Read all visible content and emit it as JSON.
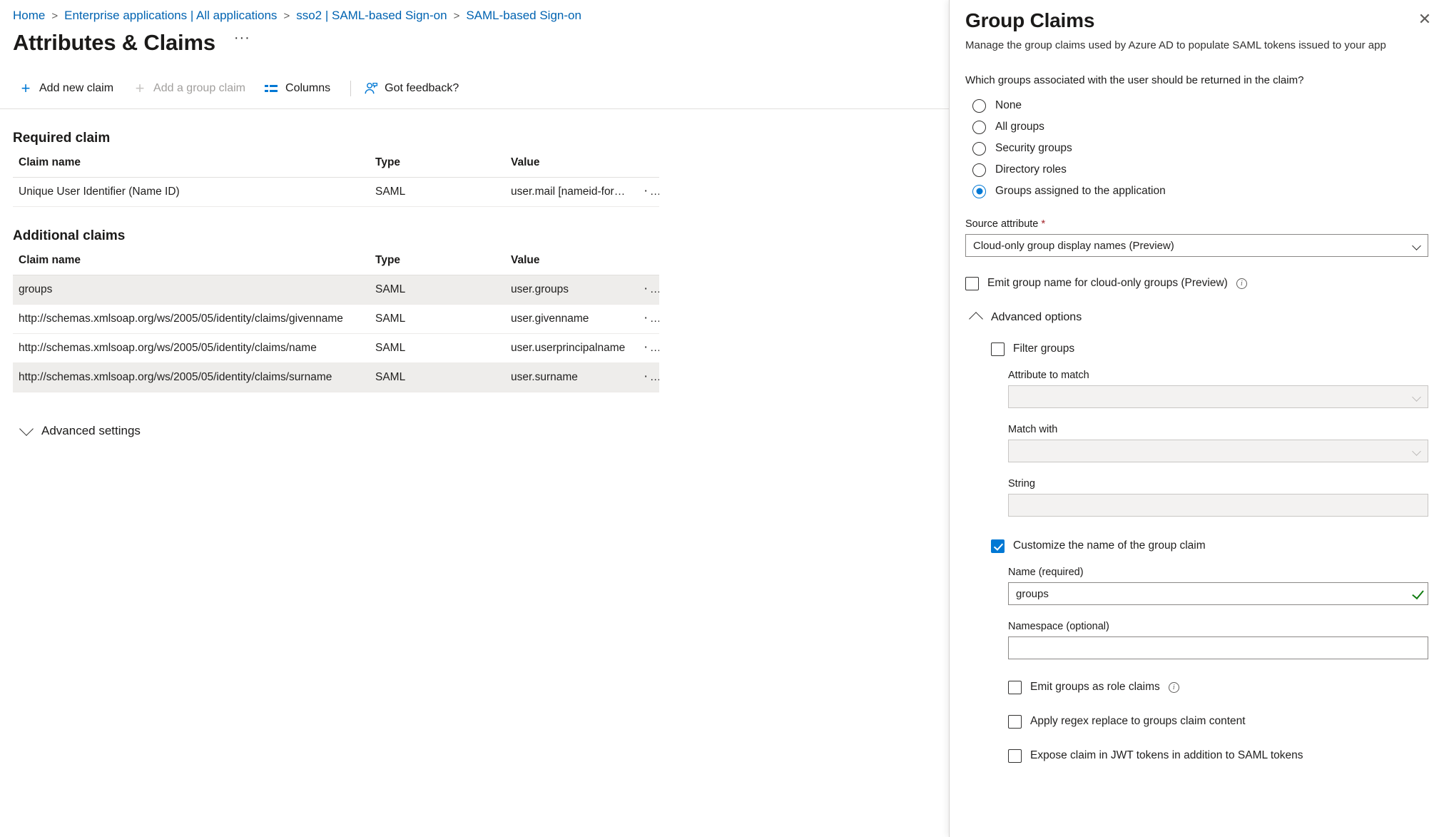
{
  "breadcrumb": [
    "Home",
    "Enterprise applications | All applications",
    "sso2 | SAML-based Sign-on",
    "SAML-based Sign-on"
  ],
  "page": {
    "title": "Attributes & Claims",
    "ellipsis": "···"
  },
  "toolbar": {
    "add_new_claim": "Add new claim",
    "add_group_claim": "Add a group claim",
    "columns": "Columns",
    "got_feedback": "Got feedback?"
  },
  "required_claim": {
    "heading": "Required claim",
    "columns": [
      "Claim name",
      "Type",
      "Value"
    ],
    "rows": [
      {
        "name": "Unique User Identifier (Name ID)",
        "type": "SAML",
        "value": "user.mail [nameid-forma…",
        "menu": "···"
      }
    ]
  },
  "additional_claims": {
    "heading": "Additional claims",
    "columns": [
      "Claim name",
      "Type",
      "Value"
    ],
    "rows": [
      {
        "name": "groups",
        "type": "SAML",
        "value": "user.groups",
        "menu": "···"
      },
      {
        "name": "http://schemas.xmlsoap.org/ws/2005/05/identity/claims/givenname",
        "type": "SAML",
        "value": "user.givenname",
        "menu": "···"
      },
      {
        "name": "http://schemas.xmlsoap.org/ws/2005/05/identity/claims/name",
        "type": "SAML",
        "value": "user.userprincipalname",
        "menu": "···"
      },
      {
        "name": "http://schemas.xmlsoap.org/ws/2005/05/identity/claims/surname",
        "type": "SAML",
        "value": "user.surname",
        "menu": "···"
      }
    ]
  },
  "advanced_settings": {
    "label": "Advanced settings",
    "expanded": false
  },
  "panel": {
    "title": "Group Claims",
    "subtitle": "Manage the group claims used by Azure AD to populate SAML tokens issued to your app",
    "close": "✕",
    "question": "Which groups associated with the user should be returned in the claim?",
    "radio_options": [
      {
        "label": "None",
        "selected": false
      },
      {
        "label": "All groups",
        "selected": false
      },
      {
        "label": "Security groups",
        "selected": false
      },
      {
        "label": "Directory roles",
        "selected": false
      },
      {
        "label": "Groups assigned to the application",
        "selected": true
      }
    ],
    "source_attribute": {
      "label": "Source attribute",
      "required_marker": "*",
      "value": "Cloud-only group display names (Preview)"
    },
    "emit_group_name": {
      "label": "Emit group name for cloud-only groups (Preview)",
      "checked": false,
      "info": "i"
    },
    "advanced_options": {
      "label": "Advanced options",
      "expanded": true,
      "filter_groups": {
        "label": "Filter groups",
        "checked": false
      },
      "attribute_to_match": {
        "label": "Attribute to match",
        "value": "",
        "disabled": true
      },
      "match_with": {
        "label": "Match with",
        "value": "",
        "disabled": true
      },
      "string": {
        "label": "String",
        "value": "",
        "disabled": true
      },
      "customize_name": {
        "label": "Customize the name of the group claim",
        "checked": true
      },
      "name_required": {
        "label": "Name (required)",
        "value": "groups",
        "valid": true
      },
      "namespace": {
        "label": "Namespace (optional)",
        "value": ""
      },
      "emit_groups_as_role_claims": {
        "label": "Emit groups as role claims",
        "checked": false,
        "info": "i"
      },
      "apply_regex_replace": {
        "label": "Apply regex replace to groups claim content",
        "checked": false
      },
      "expose_claim_jwt": {
        "label": "Expose claim in JWT tokens in addition to SAML tokens",
        "checked": false
      }
    }
  },
  "colors": {
    "accent": "#0078d4",
    "link": "#0063b1",
    "required": "#a4262c",
    "valid": "#107c10"
  }
}
